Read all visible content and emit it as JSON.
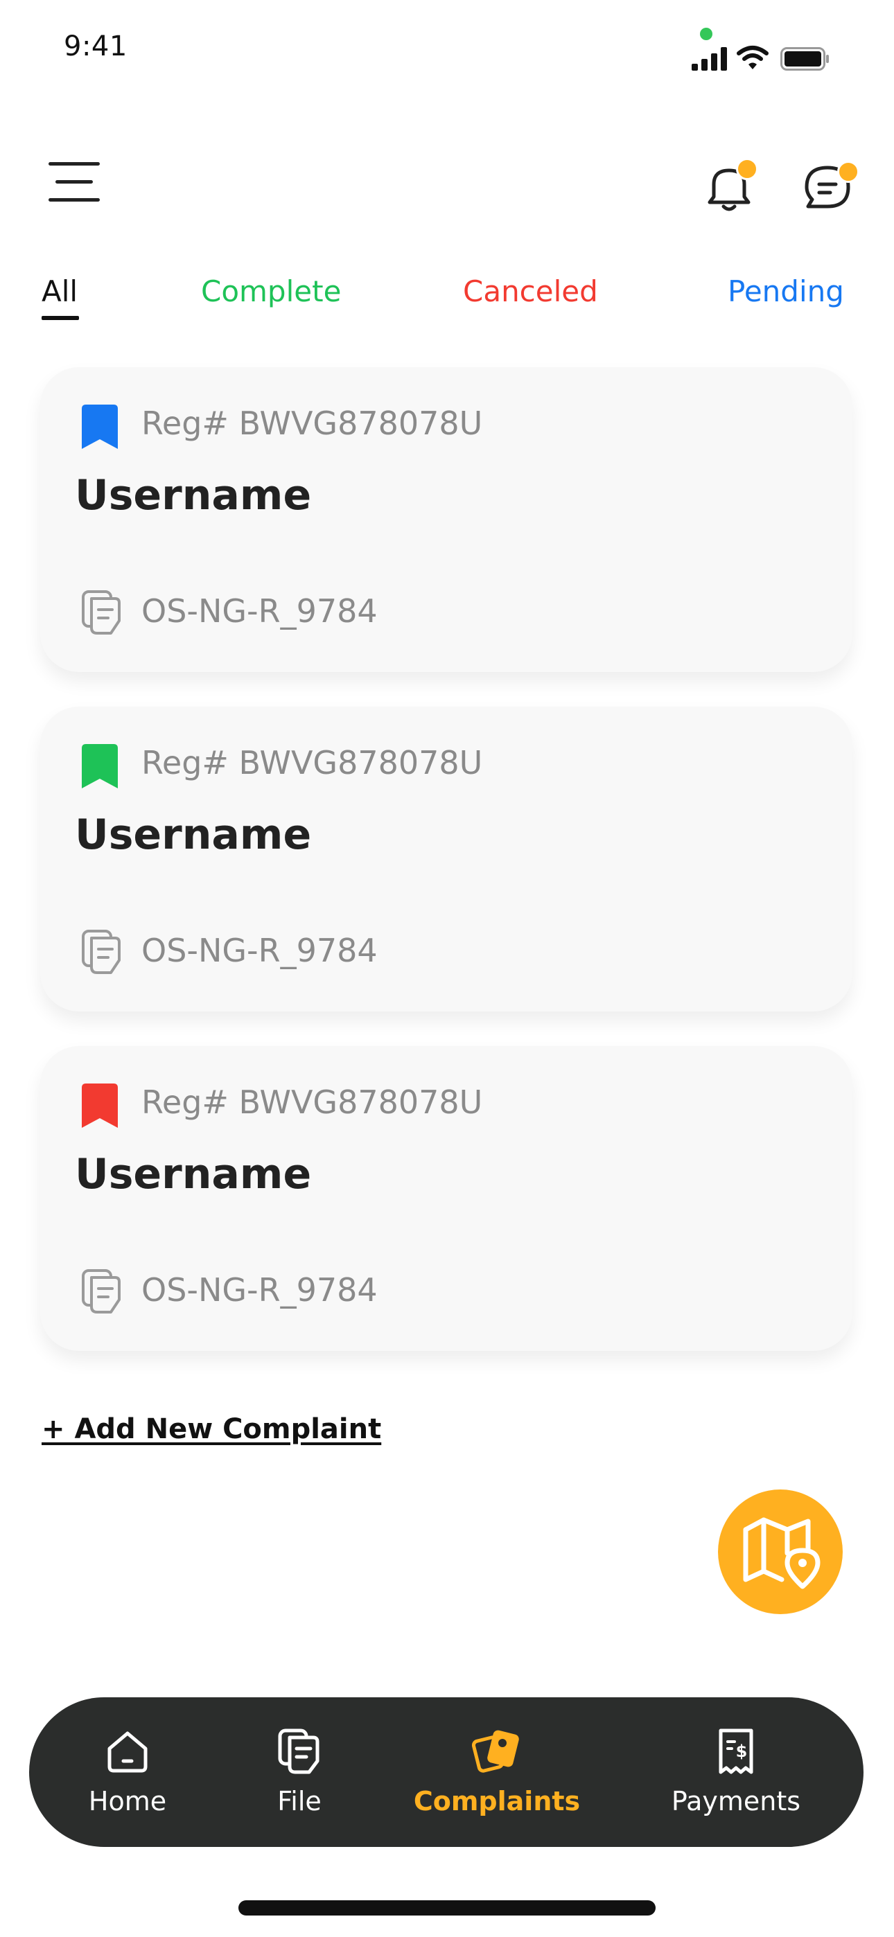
{
  "status_bar": {
    "time": "9:41"
  },
  "tabs": [
    {
      "label": "All",
      "color": "#111111",
      "active": true
    },
    {
      "label": "Complete",
      "color": "#1ec257"
    },
    {
      "label": "Canceled",
      "color": "#f23a30"
    },
    {
      "label": "Pending",
      "color": "#1778f2"
    }
  ],
  "complaints": [
    {
      "bookmark_color": "#1778f2",
      "reg": "Reg# BWVG878078U",
      "username": "Username",
      "code": "OS-NG-R_9784"
    },
    {
      "bookmark_color": "#1ec257",
      "reg": "Reg# BWVG878078U",
      "username": "Username",
      "code": "OS-NG-R_9784"
    },
    {
      "bookmark_color": "#f23a30",
      "reg": "Reg# BWVG878078U",
      "username": "Username",
      "code": "OS-NG-R_9784"
    }
  ],
  "add_link": "+ Add New Complaint",
  "nav": [
    {
      "label": "Home",
      "icon": "home-icon"
    },
    {
      "label": "File",
      "icon": "file-icon"
    },
    {
      "label": "Complaints",
      "icon": "complaints-icon",
      "active": true
    },
    {
      "label": "Payments",
      "icon": "receipt-icon"
    }
  ],
  "colors": {
    "accent": "#ffb020",
    "nav_bg": "#2b2d2c",
    "card_bg": "#f8f8f8"
  },
  "icons": {
    "header": [
      "menu-icon",
      "bell-icon",
      "chat-icon"
    ],
    "fab": "map-pin-icon"
  }
}
